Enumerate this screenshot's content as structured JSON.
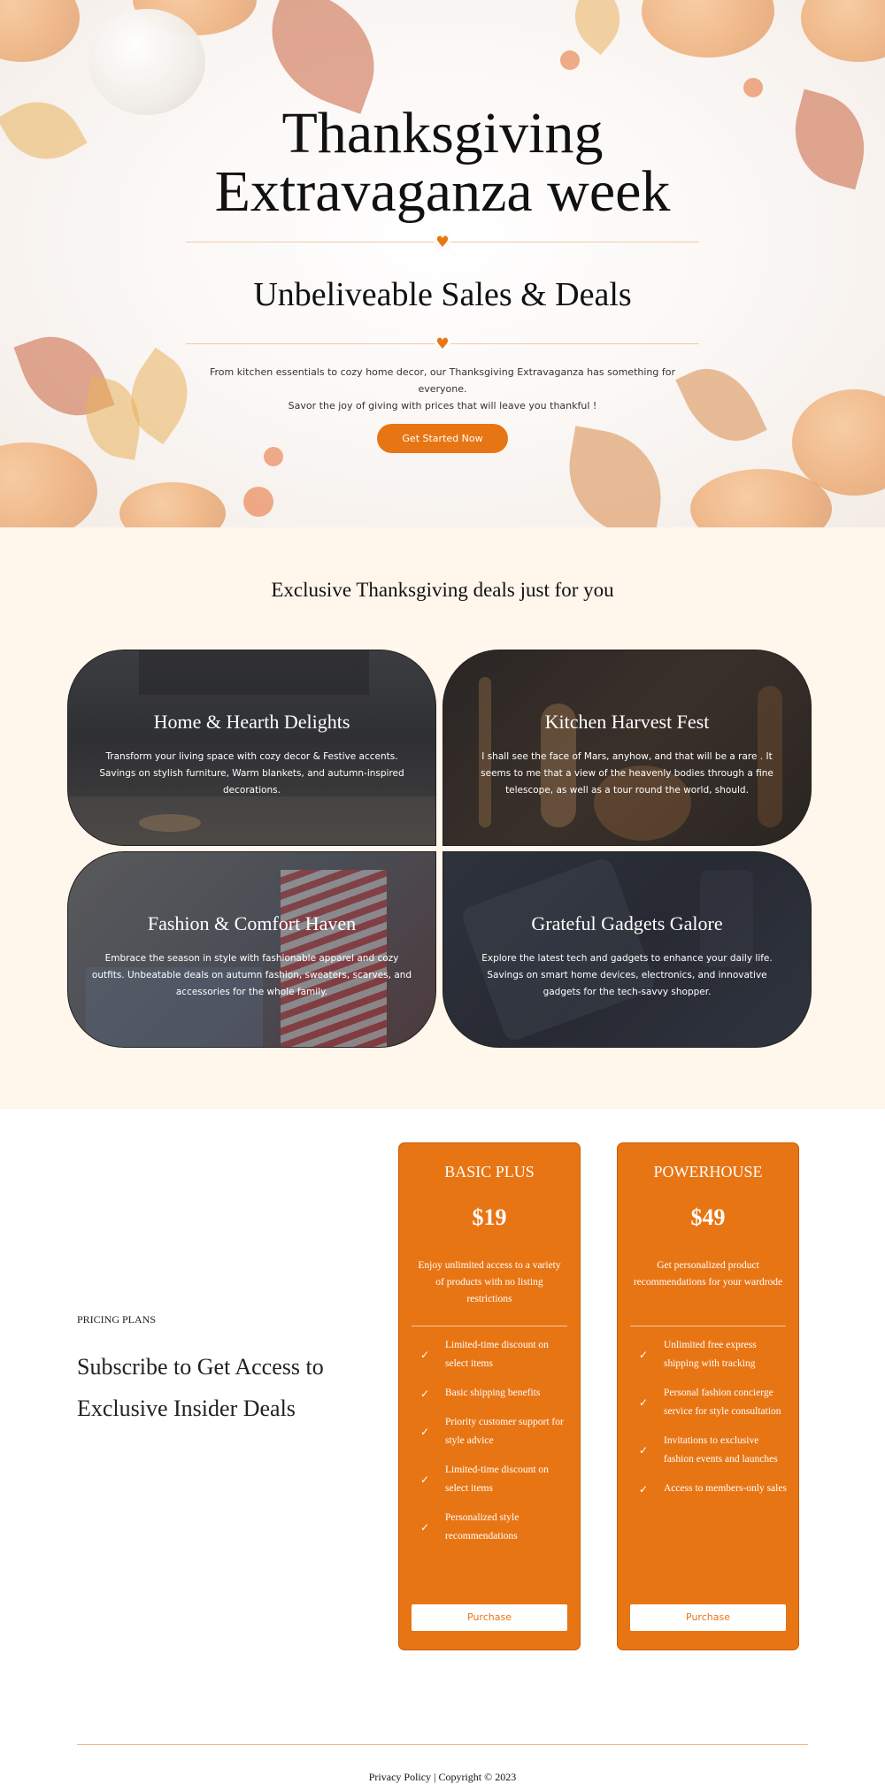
{
  "hero": {
    "title_line1": "Thanksgiving",
    "title_line2": "Extravaganza week",
    "subtitle": "Unbeliveable Sales & Deals",
    "desc_line1": "From kitchen essentials to cozy home decor, our Thanksgiving Extravaganza has something for everyone.",
    "desc_line2": "Savor the joy of giving with prices that will leave you thankful !",
    "cta": "Get Started Now",
    "heart": "♥"
  },
  "deals": {
    "title": "Exclusive Thanksgiving deals just for you",
    "cards": [
      {
        "title": "Home & Hearth Delights",
        "text": "Transform your living space with cozy decor & Festive accents. Savings on stylish furniture, Warm blankets, and autumn-inspired decorations."
      },
      {
        "title": "Kitchen Harvest Fest",
        "text": "I shall see the face of Mars, anyhow, and that will be a rare . It seems to me that a view of the heavenly bodies through a fine telescope, as well as a tour round the world, should."
      },
      {
        "title": "Fashion & Comfort Haven",
        "text": "Embrace the season in style with fashionable apparel and cozy outfits. Unbeatable deals on autumn fashion, sweaters, scarves, and accessories for the whole family."
      },
      {
        "title": "Grateful Gadgets Galore",
        "text": "Explore the latest tech and gadgets to enhance your daily life. Savings on smart home devices, electronics, and innovative gadgets for the tech-savvy shopper."
      }
    ]
  },
  "pricing": {
    "label": "PRICING PLANS",
    "heading": "Subscribe to Get Access to Exclusive Insider Deals",
    "check_icon": "✓",
    "plans": [
      {
        "name": "BASIC PLUS",
        "price": "$19",
        "desc": "Enjoy unlimited access to a variety of products with no listing restrictions",
        "features": [
          "Limited-time discount on select items",
          "Basic shipping benefits",
          "Priority customer support for style advice",
          "Limited-time discount on select items",
          "Personalized style recommendations"
        ],
        "button": "Purchase"
      },
      {
        "name": "POWERHOUSE",
        "price": "$49",
        "desc": "Get personalized product recommendations for your wardrode",
        "features": [
          "Unlimited free express shipping with tracking",
          "Personal fashion concierge service for style consultation",
          "Invitations to exclusive fashion events and launches",
          "Access to members-only sales"
        ],
        "button": "Purchase"
      }
    ]
  },
  "footer": {
    "text": "Privacy Policy | Copyright © 2023"
  },
  "colors": {
    "accent": "#e87514",
    "deals_bg": "#fff6ec"
  }
}
